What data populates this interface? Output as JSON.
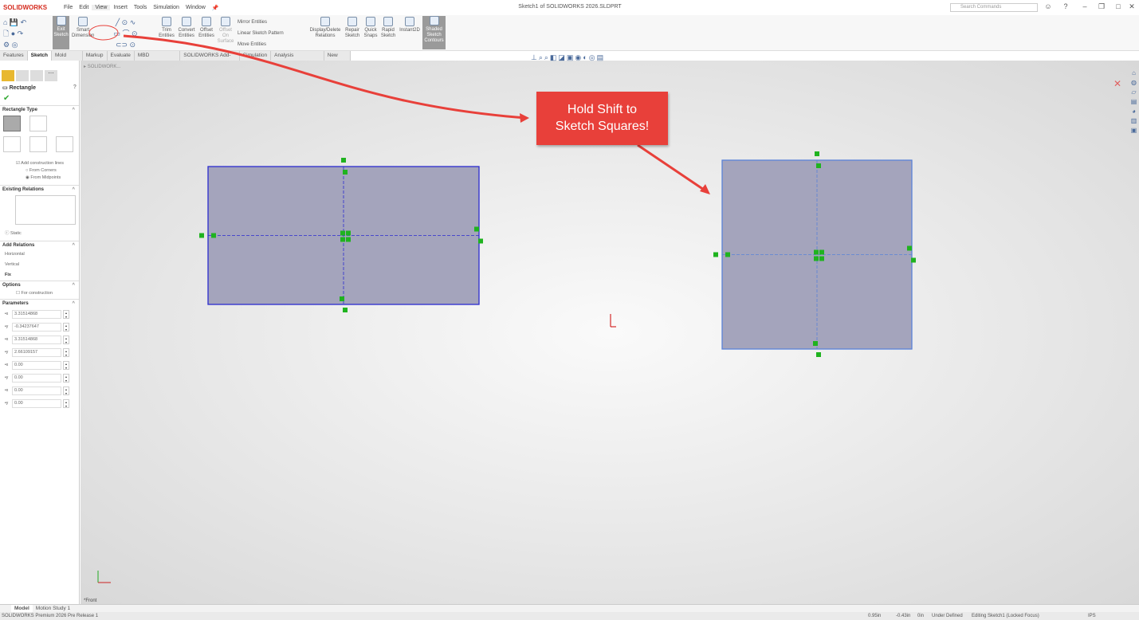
{
  "app": {
    "logo": "SOLIDWORKS",
    "title": "Sketch1 of SOLIDWORKS 2026.SLDPRT",
    "search_placeholder": "Search Commands"
  },
  "menu": [
    "File",
    "Edit",
    "View",
    "Insert",
    "Tools",
    "Simulation",
    "Window"
  ],
  "toolbar": {
    "exit_sketch": "Exit Sketch",
    "smart_dimension": "Smart Dimension",
    "trim": "Trim Entities",
    "convert": "Convert Entities",
    "offset": "Offset Entities",
    "offset_on": "Offset On Surface",
    "mirror": "Mirror Entities",
    "linear_pattern": "Linear Sketch Pattern",
    "move": "Move Entities",
    "display_delete": "Display/Delete Relations",
    "repair": "Repair Sketch",
    "quick_snaps": "Quick Snaps",
    "rapid_sketch": "Rapid Sketch",
    "instant2d": "Instant2D",
    "shaded": "Shaded Sketch Contours"
  },
  "tabs": [
    "Features",
    "Sketch",
    "Mold Tools",
    "Markup",
    "Evaluate",
    "MBD Dimensions",
    "SOLIDWORKS Add-Ins",
    "Simulation",
    "Analysis Preparation",
    "New Tab"
  ],
  "panel": {
    "title": "Rectangle",
    "rect_type": "Rectangle Type",
    "add_construction": "Add construction lines",
    "from_corners": "From Corners",
    "from_midpoints": "From Midpoints",
    "existing_relations": "Existing Relations",
    "static": "Static",
    "add_relations": "Add Relations",
    "horizontal": "Horizontal",
    "vertical": "Vertical",
    "fix": "Fix",
    "options": "Options",
    "for_construction": "For construction",
    "parameters": "Parameters",
    "params": [
      "3.31514868",
      "-0.34237647",
      "3.31514868",
      "2.66109157",
      "0.00",
      "0.00",
      "0.00",
      "0.00"
    ]
  },
  "tree": {
    "root": "SOLIDWORK..."
  },
  "callout": {
    "line1": "Hold Shift to",
    "line2": "Sketch Squares!",
    "color": "#e8403a"
  },
  "view_label": "*Front",
  "bottom_tabs": [
    "Model",
    "Motion Study 1"
  ],
  "status": {
    "product": "SOLIDWORKS Premium 2026 Pre Release 1",
    "x": "0.95in",
    "y": "-0.43in",
    "z": "0in",
    "state": "Under Defined",
    "editing": "Editing Sketch1 (Locked Focus)",
    "units": "IPS"
  },
  "colors": {
    "sketch_fill": "#a4a4bc",
    "sketch_line": "#2b2bcf",
    "point": "#1fb31f"
  }
}
